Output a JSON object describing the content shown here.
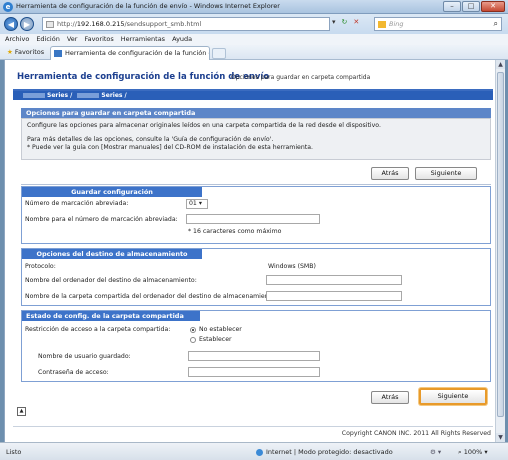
{
  "window": {
    "title": "Herramienta de configuración de la función de envío - Windows Internet Explorer"
  },
  "browser": {
    "url_prefix": "http://",
    "url_host": "192.168.0.215",
    "url_path": "/sendsupport_smb.html",
    "search_placeholder": "Bing",
    "menu": [
      "Archivo",
      "Edición",
      "Ver",
      "Favoritos",
      "Herramientas",
      "Ayuda"
    ],
    "favorites_label": "Favoritos",
    "tab_label": "Herramienta de configuración de la función de e..."
  },
  "page": {
    "app_title": "Herramienta de configuración de la función de envío",
    "app_subtitle": "Opciones para guardar en carpeta compartida",
    "breadcrumb_1": "Series /",
    "breadcrumb_2": "Series /",
    "intro": {
      "title": "Opciones para guardar en carpeta compartida",
      "line1": "Configure las opciones para almacenar originales leídos en una carpeta compartida de la red desde el dispositivo.",
      "line2": "Para más detalles de las opciones, consulte la 'Guía de configuración de envío'.",
      "line3": "* Puede ver la guía con [Mostrar manuales] del CD-ROM de instalación de esta herramienta."
    },
    "buttons": {
      "back": "Atrás",
      "next": "Siguiente"
    },
    "save_config": {
      "title": "Guardar configuración",
      "abbrev_num_label": "Número de marcación abreviada:",
      "abbrev_num_value": "01",
      "abbrev_name_label": "Nombre para el número de marcación abreviada:",
      "abbrev_name_hint": "* 16 caracteres como máximo"
    },
    "storage_dest": {
      "title": "Opciones del destino de almacenamiento",
      "protocol_label": "Protocolo:",
      "protocol_value": "Windows (SMB)",
      "host_label": "Nombre del ordenador del destino de almacenamiento:",
      "folder_label": "Nombre de la carpeta compartida del ordenador del destino de almacenamiento:"
    },
    "folder_state": {
      "title": "Estado de config. de la carpeta compartida",
      "access_label": "Restricción de acceso a la carpeta compartida:",
      "option_none": "No establecer",
      "option_set": "Establecer",
      "user_label": "Nombre de usuario guardado:",
      "password_label": "Contraseña de acceso:"
    },
    "copyright": "Copyright CANON INC. 2011 All Rights Reserved"
  },
  "status": {
    "ready": "Listo",
    "zone": "Internet | Modo protegido: desactivado",
    "zoom": "100%"
  }
}
